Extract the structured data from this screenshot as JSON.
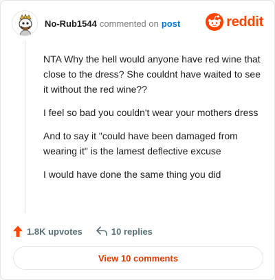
{
  "comment": {
    "username": "No-Rub1544",
    "action_text": "commented on",
    "post_link": "post",
    "paragraphs": [
      "NTA Why the hell would anyone have red wine that close to the dress? She couldnt have waited to see it without the red wine??",
      "I feel so bad you couldn't wear your mothers dress",
      "And to say it \"could have been damaged from wearing it\" is the lamest deflective excuse",
      "I would have done the same thing you did"
    ]
  },
  "brand": {
    "name": "reddit",
    "icon": "reddit-snoo-icon",
    "color": "#ff4500"
  },
  "footer": {
    "upvotes": "1.8K upvotes",
    "upvote_icon": "upvote-arrow-icon",
    "replies": "10 replies",
    "reply_icon": "reply-arrow-icon"
  },
  "view_button": "View 10 comments",
  "colors": {
    "accent": "#ff4500",
    "link": "#0079d3",
    "button_text": "#d93a00"
  }
}
